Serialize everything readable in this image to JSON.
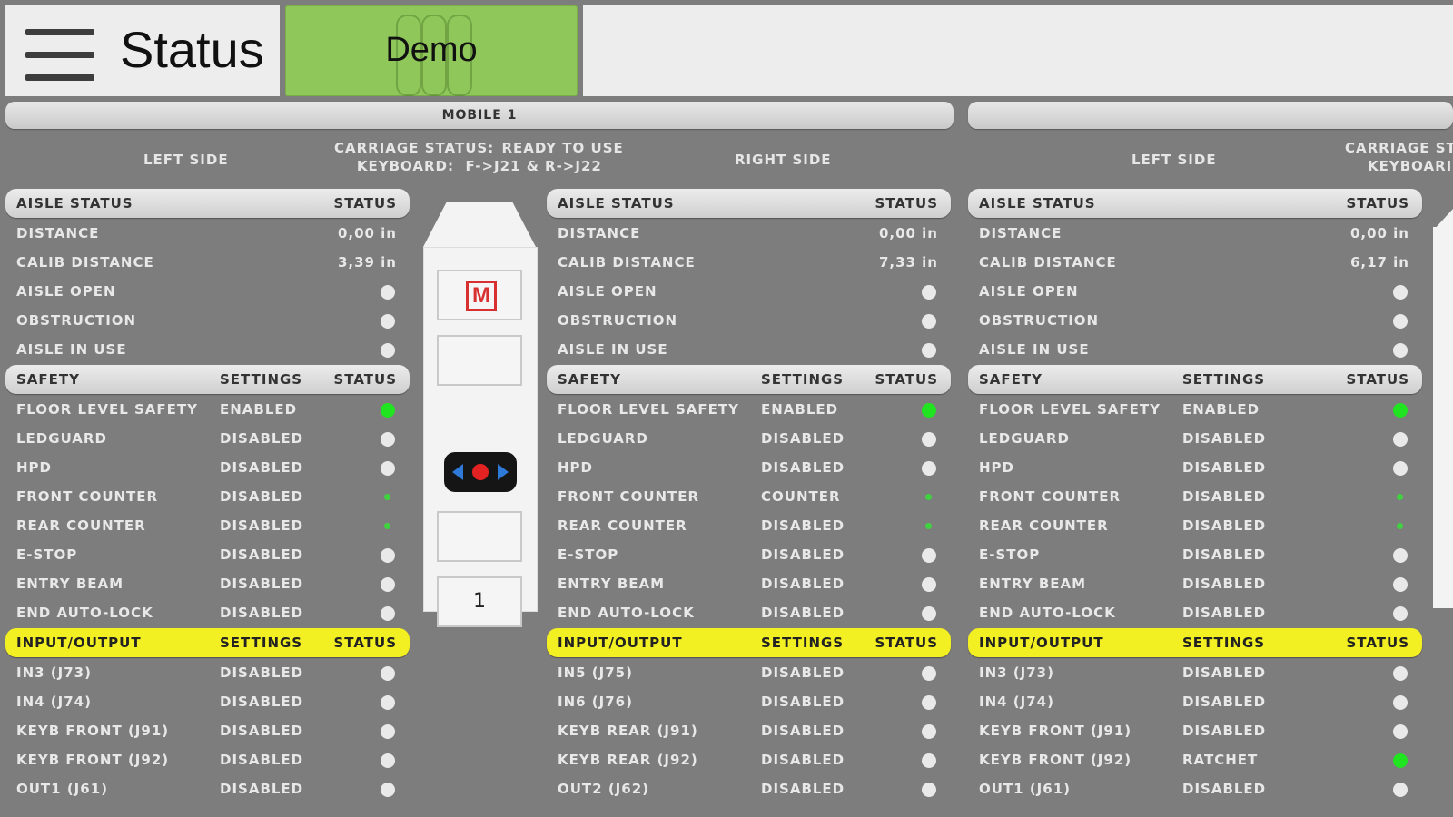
{
  "header": {
    "title": "Status",
    "demo_label": "Demo"
  },
  "mobile_bar": {
    "label": "MOBILE 1"
  },
  "left_side_label": "LEFT SIDE",
  "right_side_label": "RIGHT SIDE",
  "carriage": {
    "status_key": "CARRIAGE STATUS:",
    "status_value": "READY TO USE",
    "keyboard_key": "KEYBOARD:",
    "keyboard_value": "F->J21 & R->J22",
    "status_key_partial": "CARRIAGE ST",
    "keyboard_key_partial": "KEYBOARI"
  },
  "cart": {
    "m_label": "M",
    "number": "1"
  },
  "panels": [
    {
      "aisle": {
        "title": "AISLE STATUS",
        "status_col": "STATUS",
        "rows": [
          {
            "label": "DISTANCE",
            "value": "0,00 in"
          },
          {
            "label": "CALIB DISTANCE",
            "value": "3,39 in"
          },
          {
            "label": "AISLE OPEN",
            "dot": "white"
          },
          {
            "label": "OBSTRUCTION",
            "dot": "white"
          },
          {
            "label": "AISLE IN USE",
            "dot": "white"
          }
        ]
      },
      "safety": {
        "title": "SAFETY",
        "settings_col": "SETTINGS",
        "status_col": "STATUS",
        "rows": [
          {
            "label": "FLOOR LEVEL SAFETY",
            "setting": "ENABLED",
            "dot": "green"
          },
          {
            "label": "LEDGUARD",
            "setting": "DISABLED",
            "dot": "white"
          },
          {
            "label": "HPD",
            "setting": "DISABLED",
            "dot": "white"
          },
          {
            "label": "FRONT COUNTER",
            "setting": "DISABLED",
            "dot": "small"
          },
          {
            "label": "REAR COUNTER",
            "setting": "DISABLED",
            "dot": "small"
          },
          {
            "label": "E-STOP",
            "setting": "DISABLED",
            "dot": "white"
          },
          {
            "label": "ENTRY BEAM",
            "setting": "DISABLED",
            "dot": "white"
          },
          {
            "label": "END AUTO-LOCK",
            "setting": "DISABLED",
            "dot": "white"
          }
        ]
      },
      "io": {
        "title": "INPUT/OUTPUT",
        "settings_col": "SETTINGS",
        "status_col": "STATUS",
        "rows": [
          {
            "label": "IN3 (J73)",
            "setting": "DISABLED",
            "dot": "white"
          },
          {
            "label": "IN4 (J74)",
            "setting": "DISABLED",
            "dot": "white"
          },
          {
            "label": "KEYB FRONT (J91)",
            "setting": "DISABLED",
            "dot": "white"
          },
          {
            "label": "KEYB FRONT (J92)",
            "setting": "DISABLED",
            "dot": "white"
          },
          {
            "label": "OUT1 (J61)",
            "setting": "DISABLED",
            "dot": "white"
          }
        ]
      }
    },
    {
      "aisle": {
        "title": "AISLE STATUS",
        "status_col": "STATUS",
        "rows": [
          {
            "label": "DISTANCE",
            "value": "0,00 in"
          },
          {
            "label": "CALIB DISTANCE",
            "value": "7,33 in"
          },
          {
            "label": "AISLE OPEN",
            "dot": "white"
          },
          {
            "label": "OBSTRUCTION",
            "dot": "white"
          },
          {
            "label": "AISLE IN USE",
            "dot": "white"
          }
        ]
      },
      "safety": {
        "title": "SAFETY",
        "settings_col": "SETTINGS",
        "status_col": "STATUS",
        "rows": [
          {
            "label": "FLOOR LEVEL SAFETY",
            "setting": "ENABLED",
            "dot": "green"
          },
          {
            "label": "LEDGUARD",
            "setting": "DISABLED",
            "dot": "white"
          },
          {
            "label": "HPD",
            "setting": "DISABLED",
            "dot": "white"
          },
          {
            "label": "FRONT COUNTER",
            "setting": "COUNTER",
            "dot": "small"
          },
          {
            "label": "REAR COUNTER",
            "setting": "DISABLED",
            "dot": "small"
          },
          {
            "label": "E-STOP",
            "setting": "DISABLED",
            "dot": "white"
          },
          {
            "label": "ENTRY BEAM",
            "setting": "DISABLED",
            "dot": "white"
          },
          {
            "label": "END AUTO-LOCK",
            "setting": "DISABLED",
            "dot": "white"
          }
        ]
      },
      "io": {
        "title": "INPUT/OUTPUT",
        "settings_col": "SETTINGS",
        "status_col": "STATUS",
        "rows": [
          {
            "label": "IN5 (J75)",
            "setting": "DISABLED",
            "dot": "white"
          },
          {
            "label": "IN6 (J76)",
            "setting": "DISABLED",
            "dot": "white"
          },
          {
            "label": "KEYB REAR (J91)",
            "setting": "DISABLED",
            "dot": "white"
          },
          {
            "label": "KEYB REAR (J92)",
            "setting": "DISABLED",
            "dot": "white"
          },
          {
            "label": "OUT2 (J62)",
            "setting": "DISABLED",
            "dot": "white"
          }
        ]
      }
    },
    {
      "aisle": {
        "title": "AISLE STATUS",
        "status_col": "STATUS",
        "rows": [
          {
            "label": "DISTANCE",
            "value": "0,00 in"
          },
          {
            "label": "CALIB DISTANCE",
            "value": "6,17 in"
          },
          {
            "label": "AISLE OPEN",
            "dot": "white"
          },
          {
            "label": "OBSTRUCTION",
            "dot": "white"
          },
          {
            "label": "AISLE IN USE",
            "dot": "white"
          }
        ]
      },
      "safety": {
        "title": "SAFETY",
        "settings_col": "SETTINGS",
        "status_col": "STATUS",
        "rows": [
          {
            "label": "FLOOR LEVEL SAFETY",
            "setting": "ENABLED",
            "dot": "green"
          },
          {
            "label": "LEDGUARD",
            "setting": "DISABLED",
            "dot": "white"
          },
          {
            "label": "HPD",
            "setting": "DISABLED",
            "dot": "white"
          },
          {
            "label": "FRONT COUNTER",
            "setting": "DISABLED",
            "dot": "small"
          },
          {
            "label": "REAR COUNTER",
            "setting": "DISABLED",
            "dot": "small"
          },
          {
            "label": "E-STOP",
            "setting": "DISABLED",
            "dot": "white"
          },
          {
            "label": "ENTRY BEAM",
            "setting": "DISABLED",
            "dot": "white"
          },
          {
            "label": "END AUTO-LOCK",
            "setting": "DISABLED",
            "dot": "white"
          }
        ]
      },
      "io": {
        "title": "INPUT/OUTPUT",
        "settings_col": "SETTINGS",
        "status_col": "STATUS",
        "rows": [
          {
            "label": "IN3 (J73)",
            "setting": "DISABLED",
            "dot": "white"
          },
          {
            "label": "IN4 (J74)",
            "setting": "DISABLED",
            "dot": "white"
          },
          {
            "label": "KEYB FRONT (J91)",
            "setting": "DISABLED",
            "dot": "white"
          },
          {
            "label": "KEYB FRONT (J92)",
            "setting": "RATCHET",
            "dot": "green"
          },
          {
            "label": "OUT1 (J61)",
            "setting": "DISABLED",
            "dot": "white"
          }
        ]
      }
    }
  ],
  "colors": {
    "background": "#7d7d7d",
    "demo_green": "#8fc75a",
    "io_yellow": "#f2ef22",
    "status_green": "#21e421"
  }
}
